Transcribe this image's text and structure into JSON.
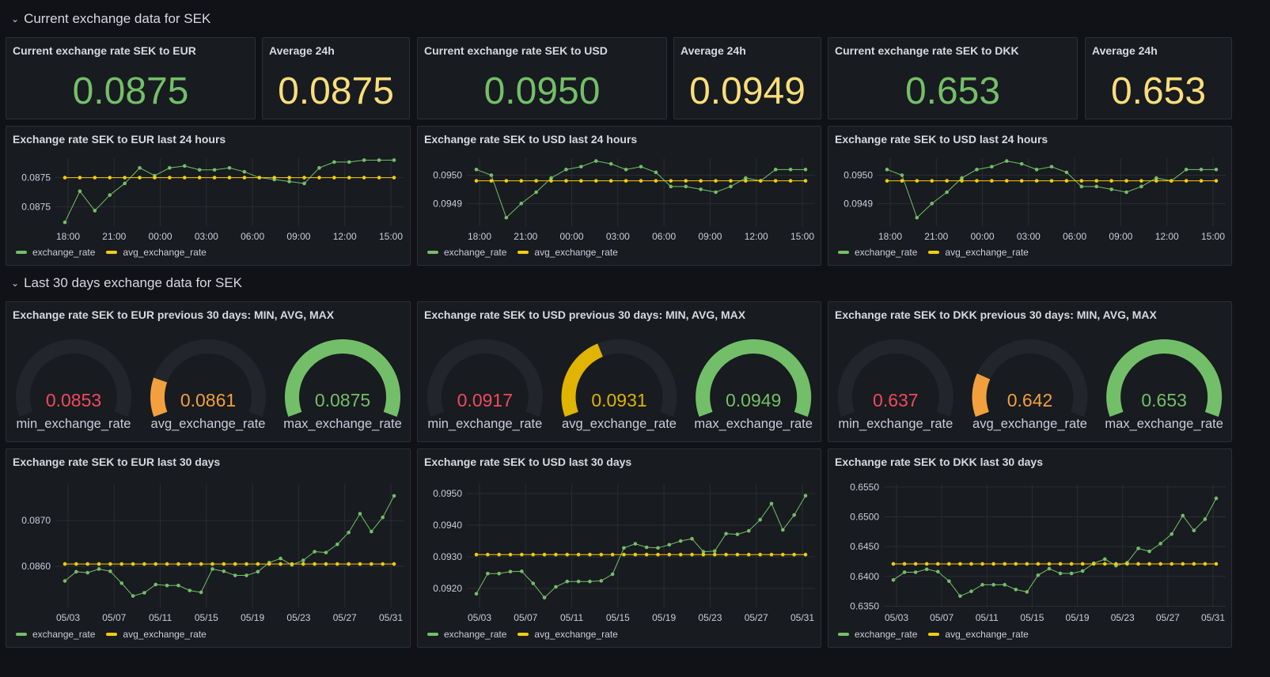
{
  "rows": {
    "current": "Current exchange data for SEK",
    "last30": "Last 30 days exchange data for SEK"
  },
  "colors": {
    "green": "#73bf69",
    "yellow": "#f2cc0c",
    "red": "#f2495c",
    "orange": "#f2a03d",
    "gauge_track": "#22252b"
  },
  "stats": [
    {
      "title": "Current exchange rate SEK to EUR",
      "value": "0.0875",
      "color": "green"
    },
    {
      "title": "Average 24h",
      "value": "0.0875",
      "color": "yellow"
    },
    {
      "title": "Current exchange rate SEK to USD",
      "value": "0.0950",
      "color": "green"
    },
    {
      "title": "Average 24h",
      "value": "0.0949",
      "color": "yellow"
    },
    {
      "title": "Current exchange rate SEK to DKK",
      "value": "0.653",
      "color": "green"
    },
    {
      "title": "Average 24h",
      "value": "0.653",
      "color": "yellow"
    }
  ],
  "legend": {
    "s1": "exchange_rate",
    "s2": "avg_exchange_rate"
  },
  "gauges": [
    {
      "title": "Exchange rate SEK to EUR previous 30 days: MIN, AVG, MAX",
      "items": [
        {
          "label": "min_exchange_rate",
          "value": "0.0853",
          "fill": 0,
          "color": "#f2495c"
        },
        {
          "label": "avg_exchange_rate",
          "value": "0.0861",
          "fill": 0.18,
          "color": "#f2a03d"
        },
        {
          "label": "max_exchange_rate",
          "value": "0.0875",
          "fill": 1,
          "color": "#73bf69"
        }
      ]
    },
    {
      "title": "Exchange rate SEK to USD previous 30 days: MIN, AVG, MAX",
      "items": [
        {
          "label": "min_exchange_rate",
          "value": "0.0917",
          "fill": 0,
          "color": "#f2495c"
        },
        {
          "label": "avg_exchange_rate",
          "value": "0.0931",
          "fill": 0.4,
          "color": "#e0b400"
        },
        {
          "label": "max_exchange_rate",
          "value": "0.0949",
          "fill": 1,
          "color": "#73bf69"
        }
      ]
    },
    {
      "title": "Exchange rate SEK to DKK previous 30 days: MIN, AVG, MAX",
      "items": [
        {
          "label": "min_exchange_rate",
          "value": "0.637",
          "fill": 0,
          "color": "#f2495c"
        },
        {
          "label": "avg_exchange_rate",
          "value": "0.642",
          "fill": 0.2,
          "color": "#f2a03d"
        },
        {
          "label": "max_exchange_rate",
          "value": "0.653",
          "fill": 1,
          "color": "#73bf69"
        }
      ]
    }
  ],
  "chart_data": [
    {
      "type": "line",
      "title": "Exchange rate SEK to EUR last 24 hours",
      "xticks": [
        "18:00",
        "21:00",
        "00:00",
        "03:00",
        "06:00",
        "09:00",
        "12:00",
        "15:00"
      ],
      "yticks": [
        "0.0875",
        "0.0875"
      ],
      "ylim": [
        0.0873,
        0.08765
      ],
      "ytick_values": [
        0.08755,
        0.0874
      ],
      "series": [
        {
          "name": "exchange_rate",
          "color": "green",
          "values": [
            0.08732,
            0.08748,
            0.08738,
            0.08746,
            0.08752,
            0.0876,
            0.08756,
            0.0876,
            0.08761,
            0.08759,
            0.08759,
            0.0876,
            0.08758,
            0.08755,
            0.08754,
            0.08753,
            0.08752,
            0.0876,
            0.08763,
            0.08763,
            0.08764,
            0.08764,
            0.08764
          ]
        },
        {
          "name": "avg_exchange_rate",
          "color": "yellow",
          "values": [
            0.08755,
            0.08755,
            0.08755,
            0.08755,
            0.08755,
            0.08755,
            0.08755,
            0.08755,
            0.08755,
            0.08755,
            0.08755,
            0.08755,
            0.08755,
            0.08755,
            0.08755,
            0.08755,
            0.08755,
            0.08755,
            0.08755,
            0.08755,
            0.08755,
            0.08755,
            0.08755
          ]
        }
      ]
    },
    {
      "type": "line",
      "title": "Exchange rate SEK to USD last 24 hours",
      "xticks": [
        "18:00",
        "21:00",
        "00:00",
        "03:00",
        "06:00",
        "09:00",
        "12:00",
        "15:00"
      ],
      "yticks": [
        "0.0950",
        "0.0949"
      ],
      "ylim": [
        0.09482,
        0.09506
      ],
      "ytick_values": [
        0.095,
        0.0949
      ],
      "series": [
        {
          "name": "exchange_rate",
          "color": "green",
          "values": [
            0.09502,
            0.095,
            0.09485,
            0.0949,
            0.09494,
            0.09499,
            0.09502,
            0.09503,
            0.09505,
            0.09504,
            0.09502,
            0.09503,
            0.09501,
            0.09496,
            0.09496,
            0.09495,
            0.09494,
            0.09496,
            0.09499,
            0.09498,
            0.09502,
            0.09502,
            0.09502
          ]
        },
        {
          "name": "avg_exchange_rate",
          "color": "yellow",
          "values": [
            0.09498,
            0.09498,
            0.09498,
            0.09498,
            0.09498,
            0.09498,
            0.09498,
            0.09498,
            0.09498,
            0.09498,
            0.09498,
            0.09498,
            0.09498,
            0.09498,
            0.09498,
            0.09498,
            0.09498,
            0.09498,
            0.09498,
            0.09498,
            0.09498,
            0.09498,
            0.09498
          ]
        }
      ]
    },
    {
      "type": "line",
      "title": "Exchange rate SEK to USD last 24 hours",
      "xticks": [
        "18:00",
        "21:00",
        "00:00",
        "03:00",
        "06:00",
        "09:00",
        "12:00",
        "15:00"
      ],
      "yticks": [
        "0.0950",
        "0.0949"
      ],
      "ylim": [
        0.09482,
        0.09506
      ],
      "ytick_values": [
        0.095,
        0.0949
      ],
      "series": [
        {
          "name": "exchange_rate",
          "color": "green",
          "values": [
            0.09502,
            0.095,
            0.09485,
            0.0949,
            0.09494,
            0.09499,
            0.09502,
            0.09503,
            0.09505,
            0.09504,
            0.09502,
            0.09503,
            0.09501,
            0.09496,
            0.09496,
            0.09495,
            0.09494,
            0.09496,
            0.09499,
            0.09498,
            0.09502,
            0.09502,
            0.09502
          ]
        },
        {
          "name": "avg_exchange_rate",
          "color": "yellow",
          "values": [
            0.09498,
            0.09498,
            0.09498,
            0.09498,
            0.09498,
            0.09498,
            0.09498,
            0.09498,
            0.09498,
            0.09498,
            0.09498,
            0.09498,
            0.09498,
            0.09498,
            0.09498,
            0.09498,
            0.09498,
            0.09498,
            0.09498,
            0.09498,
            0.09498,
            0.09498,
            0.09498
          ]
        }
      ]
    },
    {
      "type": "line",
      "title": "Exchange rate SEK to EUR last 30 days",
      "xticks": [
        "05/03",
        "05/07",
        "05/11",
        "05/15",
        "05/19",
        "05/23",
        "05/27",
        "05/31"
      ],
      "yticks": [
        "0.0870",
        "0.0860"
      ],
      "ylim": [
        0.0851,
        0.0878
      ],
      "ytick_values": [
        0.087,
        0.086
      ],
      "series": [
        {
          "name": "exchange_rate",
          "color": "green",
          "values": [
            0.08568,
            0.08588,
            0.08586,
            0.08594,
            0.08589,
            0.08563,
            0.08535,
            0.08542,
            0.0856,
            0.08558,
            0.08558,
            0.08547,
            0.08543,
            0.08594,
            0.08589,
            0.0858,
            0.0858,
            0.08588,
            0.08608,
            0.08617,
            0.08603,
            0.08613,
            0.08632,
            0.0863,
            0.08648,
            0.08674,
            0.08715,
            0.08676,
            0.08707,
            0.08754
          ]
        },
        {
          "name": "avg_exchange_rate",
          "color": "yellow",
          "values": [
            0.08605,
            0.08605,
            0.08605,
            0.08605,
            0.08605,
            0.08605,
            0.08605,
            0.08605,
            0.08605,
            0.08605,
            0.08605,
            0.08605,
            0.08605,
            0.08605,
            0.08605,
            0.08605,
            0.08605,
            0.08605,
            0.08605,
            0.08605,
            0.08605,
            0.08605,
            0.08605,
            0.08605,
            0.08605,
            0.08605,
            0.08605,
            0.08605,
            0.08605,
            0.08605
          ]
        }
      ]
    },
    {
      "type": "line",
      "title": "Exchange rate SEK to USD last 30 days",
      "xticks": [
        "05/03",
        "05/07",
        "05/11",
        "05/15",
        "05/19",
        "05/23",
        "05/27",
        "05/31"
      ],
      "yticks": [
        "0.0950",
        "0.0940",
        "0.0930",
        "0.0920"
      ],
      "ylim": [
        0.0914,
        0.0953
      ],
      "ytick_values": [
        0.095,
        0.094,
        0.093,
        0.092
      ],
      "series": [
        {
          "name": "exchange_rate",
          "color": "green",
          "values": [
            0.09183,
            0.09247,
            0.09247,
            0.09253,
            0.09254,
            0.09216,
            0.09171,
            0.09205,
            0.09222,
            0.09222,
            0.09222,
            0.09224,
            0.09245,
            0.09328,
            0.09341,
            0.0933,
            0.09328,
            0.09338,
            0.0935,
            0.09357,
            0.09316,
            0.09318,
            0.09373,
            0.09371,
            0.09382,
            0.09417,
            0.09468,
            0.09385,
            0.09432,
            0.09493
          ]
        },
        {
          "name": "avg_exchange_rate",
          "color": "yellow",
          "values": [
            0.09307,
            0.09307,
            0.09307,
            0.09307,
            0.09307,
            0.09307,
            0.09307,
            0.09307,
            0.09307,
            0.09307,
            0.09307,
            0.09307,
            0.09307,
            0.09307,
            0.09307,
            0.09307,
            0.09307,
            0.09307,
            0.09307,
            0.09307,
            0.09307,
            0.09307,
            0.09307,
            0.09307,
            0.09307,
            0.09307,
            0.09307,
            0.09307,
            0.09307,
            0.09307
          ]
        }
      ]
    },
    {
      "type": "line",
      "title": "Exchange rate SEK to DKK last 30 days",
      "xticks": [
        "05/03",
        "05/07",
        "05/11",
        "05/15",
        "05/19",
        "05/23",
        "05/27",
        "05/31"
      ],
      "yticks": [
        "0.6550",
        "0.6500",
        "0.6450",
        "0.6400",
        "0.6350"
      ],
      "ylim": [
        0.6348,
        0.6555
      ],
      "ytick_values": [
        0.655,
        0.65,
        0.645,
        0.64,
        0.635
      ],
      "series": [
        {
          "name": "exchange_rate",
          "color": "green",
          "values": [
            0.6394,
            0.6407,
            0.6407,
            0.6412,
            0.6408,
            0.6392,
            0.6367,
            0.6375,
            0.6386,
            0.6386,
            0.6386,
            0.6378,
            0.6374,
            0.6402,
            0.6413,
            0.6405,
            0.6405,
            0.6409,
            0.6422,
            0.6429,
            0.6418,
            0.6423,
            0.6447,
            0.6442,
            0.6455,
            0.6471,
            0.6502,
            0.6477,
            0.6496,
            0.6531
          ]
        },
        {
          "name": "avg_exchange_rate",
          "color": "yellow",
          "values": [
            0.6421,
            0.6421,
            0.6421,
            0.6421,
            0.6421,
            0.6421,
            0.6421,
            0.6421,
            0.6421,
            0.6421,
            0.6421,
            0.6421,
            0.6421,
            0.6421,
            0.6421,
            0.6421,
            0.6421,
            0.6421,
            0.6421,
            0.6421,
            0.6421,
            0.6421,
            0.6421,
            0.6421,
            0.6421,
            0.6421,
            0.6421,
            0.6421,
            0.6421,
            0.6421
          ]
        }
      ]
    }
  ]
}
